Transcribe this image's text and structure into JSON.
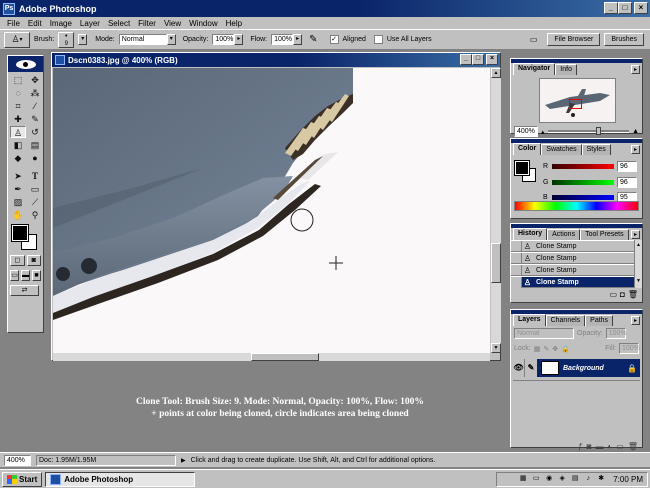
{
  "app": {
    "title": "Adobe Photoshop",
    "icon_letter": "Ps"
  },
  "menu": [
    "File",
    "Edit",
    "Image",
    "Layer",
    "Select",
    "Filter",
    "View",
    "Window",
    "Help"
  ],
  "options": {
    "brush_label": "Brush:",
    "brush_size": "9",
    "mode_label": "Mode:",
    "mode_value": "Normal",
    "opacity_label": "Opacity:",
    "opacity_value": "100%",
    "flow_label": "Flow:",
    "flow_value": "100%",
    "aligned_label": "Aligned",
    "aligned_checked": true,
    "use_all_layers_label": "Use All Layers",
    "use_all_layers_checked": false,
    "palette_well_tabs": [
      "File Browser",
      "Brushes"
    ]
  },
  "document": {
    "title": "Dscn0383.jpg @ 400% (RGB)"
  },
  "caption": {
    "line1": "Clone Tool: Brush Size: 9. Mode: Normal, Opacity: 100%, Flow: 100%",
    "line2": "+ points at color being cloned, circle indicates area being cloned"
  },
  "statusbar": {
    "zoom": "400%",
    "doc": "Doc: 1.95M/1.95M",
    "hint": "Click and drag to create duplicate. Use Shift, Alt, and Ctrl for additional options."
  },
  "navigator": {
    "tabs": [
      "Navigator",
      "Info"
    ],
    "zoom": "400%"
  },
  "color_palette": {
    "tabs": [
      "Color",
      "Swatches",
      "Styles"
    ],
    "r_label": "R",
    "r_value": "96",
    "g_label": "G",
    "g_value": "96",
    "b_label": "B",
    "b_value": "95"
  },
  "history": {
    "tabs": [
      "History",
      "Actions",
      "Tool Presets"
    ],
    "items": [
      "Clone Stamp",
      "Clone Stamp",
      "Clone Stamp",
      "Clone Stamp"
    ],
    "selected_index": 3
  },
  "layers": {
    "tabs": [
      "Layers",
      "Channels",
      "Paths"
    ],
    "mode": "Normal",
    "opacity_label": "Opacity:",
    "opacity_value": "100%",
    "lock_label": "Lock:",
    "fill_label": "Fill:",
    "fill_value": "100%",
    "layer_name": "Background"
  },
  "taskbar": {
    "start_label": "Start",
    "task_label": "Adobe Photoshop",
    "clock": "7:00 PM"
  }
}
